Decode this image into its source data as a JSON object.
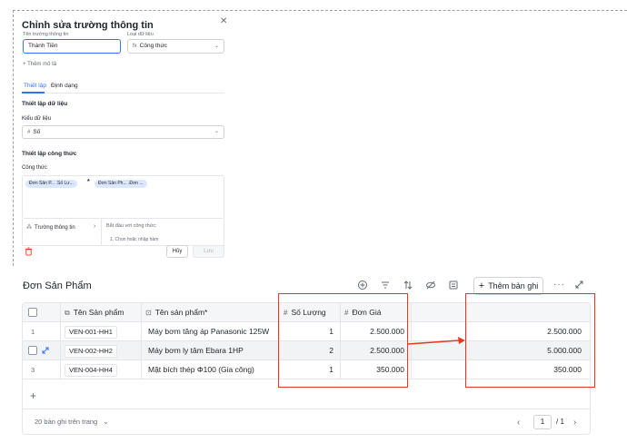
{
  "dialog": {
    "title": "Chỉnh sửa trường thông tin",
    "field_name_label": "Tên trường thông tin",
    "field_name_value": "Thành Tiền",
    "data_type_label": "Loại dữ liệu",
    "data_type_value": "Công thức",
    "data_type_icon": "fx",
    "add_description": "+ Thêm mô tả",
    "tabs": [
      "Thiết lập",
      "Định dạng"
    ],
    "data_setup_title": "Thiết lập dữ liệu",
    "data_kind_label": "Kiểu dữ liệu",
    "data_kind_value": "Số",
    "data_kind_icon": "#",
    "formula_setup_title": "Thiết lập công thức",
    "formula_label": "Công thức",
    "formula_tokens": [
      "Đơn Sản P... .Số Lư...",
      "*",
      "Đơn Sản Ph... .Đơn ..."
    ],
    "fields_panel": "Trường thông tin",
    "start_with_formula": "Bắt đầu với công thức:",
    "hint_partial": "1. Chọn hoặc nhập hàm",
    "cancel": "Hủy",
    "save": "Lưu"
  },
  "table": {
    "title": "Đơn Sản Phẩm",
    "add_record": "Thêm bản ghi",
    "columns": [
      {
        "label": "Tên Sản phẩm",
        "icon": "link-icon"
      },
      {
        "label": "Tên sản phẩm*",
        "icon": "formula-icon"
      },
      {
        "label": "Số Lượng",
        "icon": "#"
      },
      {
        "label": "Đơn Giá",
        "icon": "#"
      },
      {
        "label": ""
      },
      {
        "label": ""
      }
    ],
    "rows": [
      {
        "index": "1",
        "code": "VEN-001-HH1",
        "name": "Máy bơm tăng áp Panasonic 125W",
        "qty": "1",
        "price": "2.500.000",
        "total": "2.500.000"
      },
      {
        "index": "",
        "code": "VEN-002-HH2",
        "name": "Máy bơm ly tâm Ebara 1HP",
        "qty": "2",
        "price": "2.500.000",
        "total": "5.000.000"
      },
      {
        "index": "3",
        "code": "VEN-004-HH4",
        "name": "Mặt bích thép Φ100 (Gia công)",
        "qty": "1",
        "price": "350.000",
        "total": "350.000"
      }
    ],
    "add_row": "+",
    "per_page": "20 bản ghi trên trang",
    "page_current": "1",
    "page_total": "/ 1"
  },
  "colors": {
    "accent": "#3370ff",
    "annotation": "#e8391f"
  }
}
